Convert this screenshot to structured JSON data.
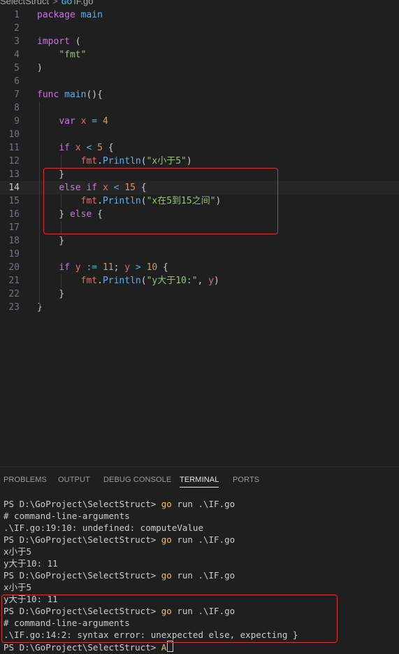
{
  "breadcrumb": {
    "folder": "SelectStruct",
    "separator": ">",
    "file_icon": "GO",
    "file": "IF.go"
  },
  "editor": {
    "current_line": 14,
    "lines": [
      {
        "n": "1",
        "tokens": [
          [
            "kw",
            "package"
          ],
          [
            "p",
            " "
          ],
          [
            "fn",
            "main"
          ]
        ]
      },
      {
        "n": "2",
        "tokens": []
      },
      {
        "n": "3",
        "tokens": [
          [
            "kw",
            "import"
          ],
          [
            "p",
            " ("
          ]
        ]
      },
      {
        "n": "4",
        "tokens": [
          [
            "p",
            "    "
          ],
          [
            "str",
            "\"fmt\""
          ]
        ]
      },
      {
        "n": "5",
        "tokens": [
          [
            "p",
            ")"
          ]
        ]
      },
      {
        "n": "6",
        "tokens": []
      },
      {
        "n": "7",
        "tokens": [
          [
            "kw",
            "func"
          ],
          [
            "p",
            " "
          ],
          [
            "fn",
            "main"
          ],
          [
            "p",
            "(){"
          ]
        ]
      },
      {
        "n": "8",
        "tokens": []
      },
      {
        "n": "9",
        "tokens": [
          [
            "p",
            "    "
          ],
          [
            "kw",
            "var"
          ],
          [
            "p",
            " "
          ],
          [
            "var",
            "x"
          ],
          [
            "p",
            " "
          ],
          [
            "op",
            "="
          ],
          [
            "p",
            " "
          ],
          [
            "num",
            "4"
          ]
        ]
      },
      {
        "n": "10",
        "tokens": []
      },
      {
        "n": "11",
        "tokens": [
          [
            "p",
            "    "
          ],
          [
            "kw",
            "if"
          ],
          [
            "p",
            " "
          ],
          [
            "var",
            "x"
          ],
          [
            "p",
            " "
          ],
          [
            "op",
            "<"
          ],
          [
            "p",
            " "
          ],
          [
            "num",
            "5"
          ],
          [
            "p",
            " {"
          ]
        ]
      },
      {
        "n": "12",
        "tokens": [
          [
            "p",
            "        "
          ],
          [
            "var",
            "fmt"
          ],
          [
            "p",
            "."
          ],
          [
            "fn",
            "Println"
          ],
          [
            "p",
            "("
          ],
          [
            "str",
            "\"x小于5\""
          ],
          [
            "p",
            ")"
          ]
        ]
      },
      {
        "n": "13",
        "tokens": [
          [
            "p",
            "    }"
          ]
        ]
      },
      {
        "n": "14",
        "tokens": [
          [
            "p",
            "    "
          ],
          [
            "kw",
            "else"
          ],
          [
            "p",
            " "
          ],
          [
            "kw",
            "if"
          ],
          [
            "p",
            " "
          ],
          [
            "var",
            "x"
          ],
          [
            "p",
            " "
          ],
          [
            "op",
            "<"
          ],
          [
            "p",
            " "
          ],
          [
            "num",
            "15"
          ],
          [
            "p",
            " {"
          ]
        ]
      },
      {
        "n": "15",
        "tokens": [
          [
            "p",
            "        "
          ],
          [
            "var",
            "fmt"
          ],
          [
            "p",
            "."
          ],
          [
            "fn",
            "Println"
          ],
          [
            "p",
            "("
          ],
          [
            "str",
            "\"x在5到15之间\""
          ],
          [
            "p",
            ")"
          ]
        ]
      },
      {
        "n": "16",
        "tokens": [
          [
            "p",
            "    } "
          ],
          [
            "kw",
            "else"
          ],
          [
            "p",
            " {"
          ]
        ]
      },
      {
        "n": "17",
        "tokens": []
      },
      {
        "n": "18",
        "tokens": [
          [
            "p",
            "    }"
          ]
        ]
      },
      {
        "n": "19",
        "tokens": []
      },
      {
        "n": "20",
        "tokens": [
          [
            "p",
            "    "
          ],
          [
            "kw",
            "if"
          ],
          [
            "p",
            " "
          ],
          [
            "var",
            "y"
          ],
          [
            "p",
            " "
          ],
          [
            "op",
            ":="
          ],
          [
            "p",
            " "
          ],
          [
            "num",
            "11"
          ],
          [
            "p",
            "; "
          ],
          [
            "var",
            "y"
          ],
          [
            "p",
            " "
          ],
          [
            "op",
            ">"
          ],
          [
            "p",
            " "
          ],
          [
            "num",
            "10"
          ],
          [
            "p",
            " {"
          ]
        ]
      },
      {
        "n": "21",
        "tokens": [
          [
            "p",
            "        "
          ],
          [
            "var",
            "fmt"
          ],
          [
            "p",
            "."
          ],
          [
            "fn",
            "Println"
          ],
          [
            "p",
            "("
          ],
          [
            "str",
            "\"y大于10:\""
          ],
          [
            "p",
            ", "
          ],
          [
            "var",
            "y"
          ],
          [
            "p",
            ")"
          ]
        ]
      },
      {
        "n": "22",
        "tokens": [
          [
            "p",
            "    }"
          ]
        ]
      },
      {
        "n": "23",
        "tokens": [
          [
            "p",
            "}"
          ]
        ]
      }
    ]
  },
  "panel": {
    "tabs": [
      {
        "label": "PROBLEMS",
        "active": false
      },
      {
        "label": "OUTPUT",
        "active": false
      },
      {
        "label": "DEBUG CONSOLE",
        "active": false
      },
      {
        "label": "TERMINAL",
        "active": true
      },
      {
        "label": "PORTS",
        "active": false
      }
    ],
    "terminal": [
      {
        "prompt": "PS D:\\GoProject\\SelectStruct> ",
        "cmd": "go",
        "args": " run .\\IF.go"
      },
      {
        "text": "# command-line-arguments"
      },
      {
        "text": ".\\IF.go:19:10: undefined: computeValue"
      },
      {
        "prompt": "PS D:\\GoProject\\SelectStruct> ",
        "cmd": "go",
        "args": " run .\\IF.go"
      },
      {
        "text": "x小于5"
      },
      {
        "text": "y大于10: 11"
      },
      {
        "prompt": "PS D:\\GoProject\\SelectStruct> ",
        "cmd": "go",
        "args": " run .\\IF.go"
      },
      {
        "text": "x小于5"
      },
      {
        "text": "y大于10: 11"
      },
      {
        "prompt": "PS D:\\GoProject\\SelectStruct> ",
        "cmd": "go",
        "args": " run .\\IF.go"
      },
      {
        "text": "# command-line-arguments"
      },
      {
        "text": ".\\IF.go:14:2: syntax error: unexpected else, expecting }"
      },
      {
        "prompt": "PS D:\\GoProject\\SelectStruct> ",
        "cmd": "A",
        "args": "",
        "cursor": true
      }
    ]
  },
  "colors": {
    "background": "#1f1f1f",
    "keyword": "#c678dd",
    "function": "#61afef",
    "string": "#98c379",
    "number": "#d19a66",
    "variable": "#e06c75",
    "annotation_box": "#d93232"
  }
}
